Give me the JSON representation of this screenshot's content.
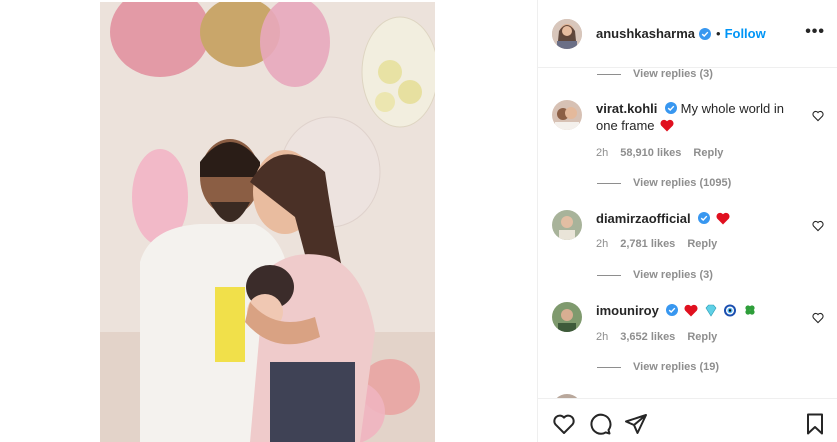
{
  "post": {
    "username": "anushkasharma",
    "separator": "•",
    "follow_label": "Follow",
    "more_icon": "more-options-icon",
    "more_label": "•••"
  },
  "comments": {
    "top_view_replies": "View replies (3)",
    "items": [
      {
        "username": "virat.kohli",
        "verified": true,
        "text": "My whole world in one frame",
        "emoji": [
          "red-heart"
        ],
        "time": "2h",
        "likes": "58,910 likes",
        "reply_label": "Reply",
        "view_replies": "View replies (1095)"
      },
      {
        "username": "diamirzaofficial",
        "verified": true,
        "text": "",
        "emoji": [
          "red-heart"
        ],
        "time": "2h",
        "likes": "2,781 likes",
        "reply_label": "Reply",
        "view_replies": "View replies (3)"
      },
      {
        "username": "imouniroy",
        "verified": true,
        "text": "",
        "emoji": [
          "red-heart",
          "gem",
          "nazar-amulet",
          "four-leaf-clover"
        ],
        "time": "2h",
        "likes": "3,652 likes",
        "reply_label": "Reply",
        "view_replies": "View replies (19)"
      }
    ]
  },
  "actions": [
    "like-icon",
    "comment-icon",
    "share-icon",
    "save-icon"
  ],
  "colors": {
    "link_blue": "#0095f6",
    "verified_blue": "#3897f0",
    "muted_text": "#8e8e8e",
    "heart_red": "#ed4956"
  }
}
